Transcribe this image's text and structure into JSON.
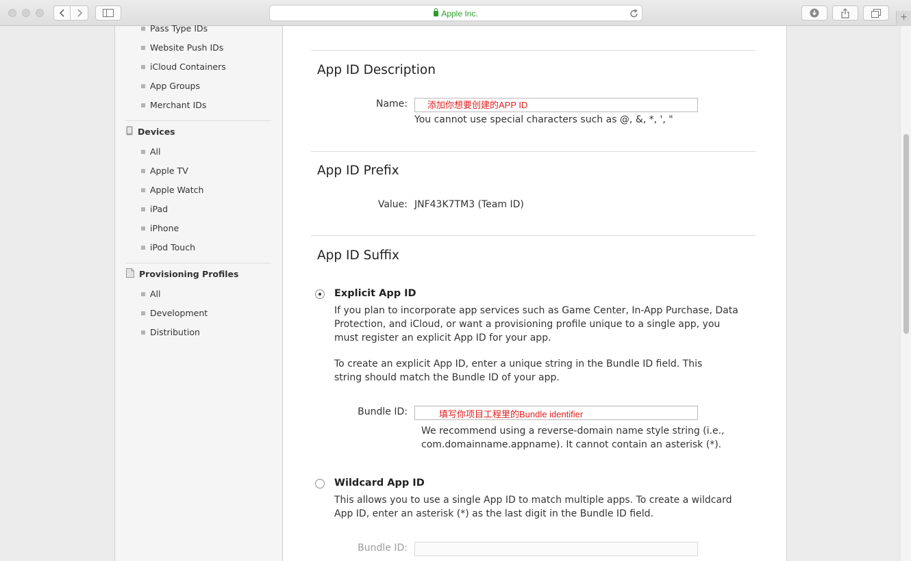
{
  "browser": {
    "address_text": "Apple Inc.",
    "new_tab_label": "+"
  },
  "sidebar": {
    "ids_items": [
      {
        "label": "Pass Type IDs"
      },
      {
        "label": "Website Push IDs"
      },
      {
        "label": "iCloud Containers"
      },
      {
        "label": "App Groups"
      },
      {
        "label": "Merchant IDs"
      }
    ],
    "devices": {
      "heading": "Devices",
      "items": [
        {
          "label": "All"
        },
        {
          "label": "Apple TV"
        },
        {
          "label": "Apple Watch"
        },
        {
          "label": "iPad"
        },
        {
          "label": "iPhone"
        },
        {
          "label": "iPod Touch"
        }
      ]
    },
    "profiles": {
      "heading": "Provisioning Profiles",
      "items": [
        {
          "label": "All"
        },
        {
          "label": "Development"
        },
        {
          "label": "Distribution"
        }
      ]
    }
  },
  "main": {
    "description": {
      "title": "App ID Description",
      "name_label": "Name:",
      "name_value": "添加你想要创建的APP ID",
      "hint": "You cannot use special characters such as @, &, *, ', \""
    },
    "prefix": {
      "title": "App ID Prefix",
      "value_label": "Value:",
      "value": "JNF43K7TM3 (Team ID)"
    },
    "suffix": {
      "title": "App ID Suffix",
      "explicit": {
        "title": "Explicit App ID",
        "checked": true,
        "para1": "If you plan to incorporate app services such as Game Center, In-App Purchase, Data Protection, and iCloud, or want a provisioning profile unique to a single app, you must register an explicit App ID for your app.",
        "para2": "To create an explicit App ID, enter a unique string in the Bundle ID field. This string should match the Bundle ID of your app.",
        "bundle_label": "Bundle ID:",
        "bundle_value": "填写你项目工程里的Bundle identifier",
        "bundle_hint": "We recommend using a reverse-domain name style string (i.e., com.domainname.appname). It cannot contain an asterisk (*)."
      },
      "wildcard": {
        "title": "Wildcard App ID",
        "checked": false,
        "para": "This allows you to use a single App ID to match multiple apps. To create a wildcard App ID, enter an asterisk (*) as the last digit in the Bundle ID field.",
        "bundle_label": "Bundle ID:",
        "bundle_value": ""
      }
    }
  }
}
